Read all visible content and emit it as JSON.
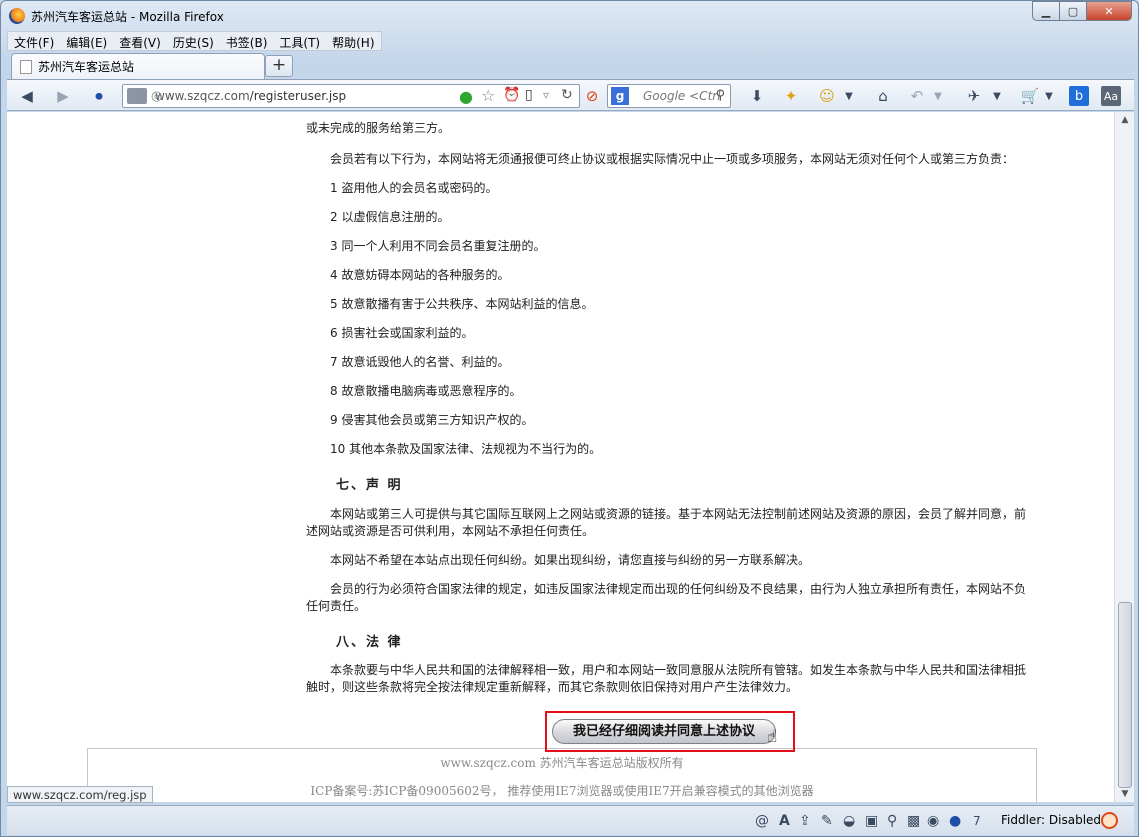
{
  "window": {
    "title": "苏州汽车客运总站 - Mozilla Firefox",
    "menu": [
      "文件(F)",
      "编辑(E)",
      "查看(V)",
      "历史(S)",
      "书签(B)",
      "工具(T)",
      "帮助(H)"
    ],
    "tab_title": "苏州汽车客运总站",
    "new_tab_label": "+",
    "url_host": "www.szqcz.com",
    "url_path": "/registeruser.jsp",
    "search_engine_letter": "g",
    "search_placeholder": "Google <Ctrl"
  },
  "page": {
    "top_partial": "或未完成的服务给第三方。",
    "items": [
      {
        "id": "intro",
        "text": "会员若有以下行为，本网站将无须通报便可终止协议或根据实际情况中止一项或多项服务，本网站无须对任何个人或第三方负责："
      },
      {
        "id": "l1",
        "text": "1 盗用他人的会员名或密码的。"
      },
      {
        "id": "l2",
        "text": "2 以虚假信息注册的。"
      },
      {
        "id": "l3",
        "text": "3 同一个人利用不同会员名重复注册的。"
      },
      {
        "id": "l4",
        "text": "4 故意妨碍本网站的各种服务的。"
      },
      {
        "id": "l5",
        "text": "5 故意散播有害于公共秩序、本网站利益的信息。"
      },
      {
        "id": "l6",
        "text": "6 损害社会或国家利益的。"
      },
      {
        "id": "l7",
        "text": "7 故意诋毁他人的名誉、利益的。"
      },
      {
        "id": "l8",
        "text": "8 故意散播电脑病毒或恶意程序的。"
      },
      {
        "id": "l9",
        "text": "9 侵害其他会员或第三方知识产权的。"
      },
      {
        "id": "l10",
        "text": "10 其他本条款及国家法律、法规视为不当行为的。"
      }
    ],
    "section7_title": "七、声 明",
    "section7": [
      "本网站或第三人可提供与其它国际互联网上之网站或资源的链接。基于本网站无法控制前述网站及资源的原因，会员了解并同意，前述网站或资源是否可供利用，本网站不承担任何责任。",
      "本网站不希望在本站点出现任何纠纷。如果出现纠纷，请您直接与纠纷的另一方联系解决。",
      "会员的行为必须符合国家法律的规定，如违反国家法律规定而出现的任何纠纷及不良结果，由行为人独立承担所有责任，本网站不负任何责任。"
    ],
    "section8_title": "八、法 律",
    "section8": [
      "本条款要与中华人民共和国的法律解释相一致，用户和本网站一致同意服从法院所有管辖。如发生本条款与中华人民共和国法律相抵触时，则这些条款将完全按法律规定重新解释，而其它条款则依旧保持对用户产生法律效力。"
    ],
    "agree_button": "我已经仔细阅读并同意上述协议",
    "footer_line1": "www.szqcz.com 苏州汽车客运总站版权所有",
    "footer_line2": "ICP备案号:苏ICP备09005602号， 推荐使用IE7浏览器或使用IE7开启兼容模式的其他浏览器"
  },
  "status": {
    "link_preview": "www.szqcz.com/reg.jsp",
    "count": "7",
    "fiddler": "Fiddler: Disabled"
  }
}
